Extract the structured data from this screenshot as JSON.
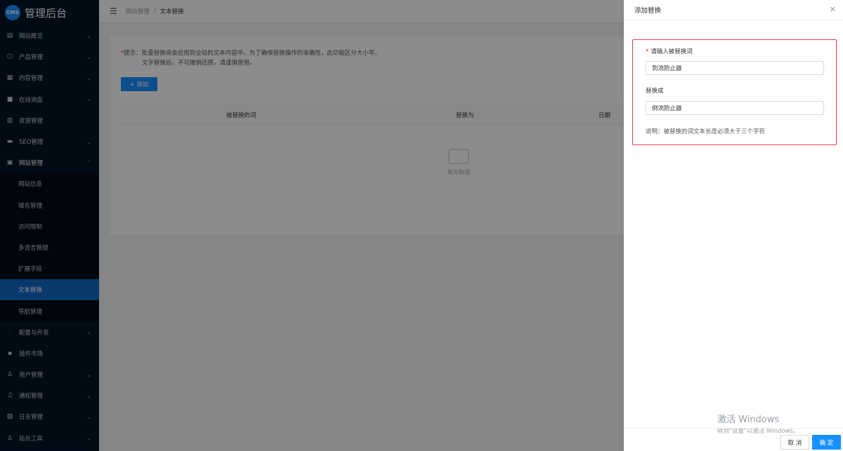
{
  "app": {
    "logo_badge": "CMS",
    "title": "管理后台"
  },
  "sidebar": {
    "items_top": [
      {
        "label": "网站概览",
        "icon": "monitor-icon",
        "glyph": "▤",
        "arrow": true
      },
      {
        "label": "产品管理",
        "icon": "cube-icon",
        "glyph": "⬡",
        "arrow": true
      },
      {
        "label": "内容管理",
        "icon": "document-icon",
        "glyph": "▦",
        "arrow": true
      },
      {
        "label": "在线询盘",
        "icon": "chat-icon",
        "glyph": "■",
        "arrow": true
      },
      {
        "label": "资源管理",
        "icon": "folder-icon",
        "glyph": "▥",
        "arrow": false
      },
      {
        "label": "SEO管理",
        "icon": "seo-icon",
        "glyph": "▬",
        "arrow": true
      }
    ],
    "site_group": {
      "label": "网站管理",
      "icon": "site-icon",
      "glyph": "▣",
      "arrow": "⌃"
    },
    "sub_items": [
      {
        "label": "网站信息"
      },
      {
        "label": "域名管理"
      },
      {
        "label": "访问限制"
      },
      {
        "label": "多语言管理"
      },
      {
        "label": "扩展字段"
      },
      {
        "label": "文本替换",
        "active": true
      },
      {
        "label": "导航管理"
      }
    ],
    "items_bottom": [
      {
        "label": "配置与开发",
        "icon": "sliders-icon",
        "glyph": "⫶",
        "arrow": true
      },
      {
        "label": "插件市场",
        "icon": "plugin-icon",
        "glyph": "▪",
        "arrow": false
      },
      {
        "label": "用户管理",
        "icon": "user-icon",
        "glyph": "♙",
        "arrow": true
      },
      {
        "label": "通知管理",
        "icon": "bell-icon",
        "glyph": "♫",
        "arrow": true
      },
      {
        "label": "日志管理",
        "icon": "log-icon",
        "glyph": "▧",
        "arrow": true
      },
      {
        "label": "站长工具",
        "icon": "tool-icon",
        "glyph": "♙",
        "arrow": true
      }
    ]
  },
  "header": {
    "fold_glyph": "☰",
    "breadcrumb": {
      "parent": "网站管理",
      "separator": "/",
      "current": "文本替换"
    }
  },
  "main": {
    "tip_star": "*",
    "tip_line1": "提示：批量替换将会应用到全站的文本内容中，为了确保替换操作的准确性，此功能区分大小写。",
    "tip_line2": "文字替换后，不可撤销还原，请谨慎使用。",
    "add_button": "+ 添加",
    "columns": [
      "被替换的词",
      "替换为",
      "日期"
    ],
    "empty_text": "暂无数据"
  },
  "drawer": {
    "title": "添加替换",
    "close_glyph": "✕",
    "field1_required": "*",
    "field1_label": "请输入被替换词",
    "field1_value": "到流防止器",
    "field2_label": "替换成",
    "field2_value": "倒流防止器",
    "note": "说明：被替换的词文本长度必须大于三个字符",
    "cancel": "取 消",
    "confirm": "确 定"
  },
  "watermark": {
    "line1": "激活 Windows",
    "line2": "转到\"设置\"以激活 Windows。"
  }
}
